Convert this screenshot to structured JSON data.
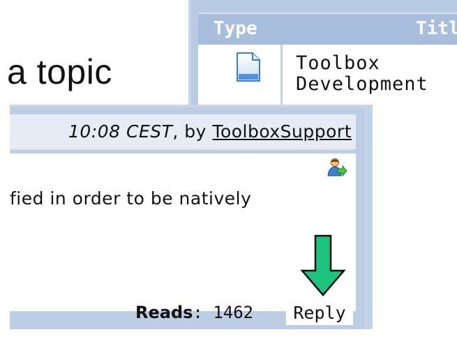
{
  "slide": {
    "text": "a topic"
  },
  "table": {
    "headers": {
      "type": "Type",
      "title": "Title"
    },
    "row": {
      "icon": "document-icon",
      "title": "Toolbox Development"
    }
  },
  "post": {
    "meta": {
      "time": "10:08 CEST",
      "by": ", by ",
      "author": "ToolboxSupport"
    },
    "icon": "user-reply-icon",
    "text": "fied in order to be natively",
    "footer": {
      "reads_label": "Reads",
      "reads_value": ": 1462",
      "reply_label": "Reply"
    }
  },
  "annotation": {
    "icon": "down-arrow-icon",
    "color": "#1ec47d"
  },
  "colors": {
    "panel": "#bccde4",
    "header": "#e6ecf4",
    "table_header": "#a9bedc"
  }
}
